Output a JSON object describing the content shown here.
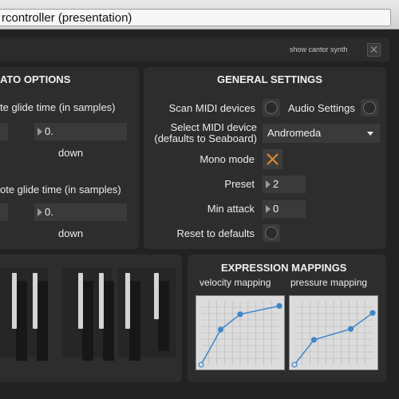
{
  "window": {
    "title": "rcontroller (presentation)"
  },
  "top": {
    "show_cantor_synth": "show cantor synth",
    "close_symbol": "✕"
  },
  "legato": {
    "title": "ATO OPTIONS",
    "glide1_label": "te glide time (in samples)",
    "glide1_value": "0.",
    "glide1_dir": "down",
    "glide2_label": "ote glide time (in samples)",
    "glide2_value": "0.",
    "glide2_dir": "down"
  },
  "general": {
    "title": "GENERAL SETTINGS",
    "scan_midi": "Scan MIDI devices",
    "audio_settings": "Audio Settings",
    "select_midi_line1": "Select MIDI device",
    "select_midi_line2": "(defaults to Seaboard)",
    "midi_device": "Andromeda",
    "mono_mode": "Mono mode",
    "mono_on": true,
    "preset_label": "Preset",
    "preset_value": "2",
    "min_attack_label": "Min attack",
    "min_attack_value": "0",
    "reset_label": "Reset to defaults",
    "accent_color": "#e8862a"
  },
  "expression": {
    "title": "EXPRESSION MAPPINGS",
    "velocity_label": "velocity mapping",
    "pressure_label": "pressure mapping",
    "line_color": "#3d86cc",
    "velocity_points": [
      [
        0,
        0
      ],
      [
        0.25,
        0.55
      ],
      [
        0.5,
        0.79
      ],
      [
        1,
        0.92
      ]
    ],
    "pressure_points": [
      [
        0,
        0
      ],
      [
        0.25,
        0.39
      ],
      [
        0.72,
        0.56
      ],
      [
        1,
        0.81
      ]
    ]
  }
}
